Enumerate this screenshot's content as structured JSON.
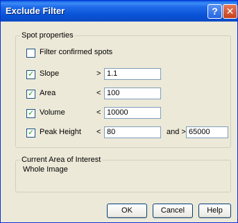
{
  "window": {
    "title": "Exclude Filter",
    "help_glyph": "?",
    "close_glyph": "✕"
  },
  "spot_properties": {
    "legend": "Spot properties",
    "filter_confirmed": {
      "label": "Filter confirmed spots",
      "checked": false
    },
    "rows": [
      {
        "label": "Slope",
        "checked": true,
        "operator": ">",
        "value": "1.1"
      },
      {
        "label": "Area",
        "checked": true,
        "operator": "<",
        "value": "100"
      },
      {
        "label": "Volume",
        "checked": true,
        "operator": "<",
        "value": "10000"
      },
      {
        "label": "Peak Height",
        "checked": true,
        "operator": "<",
        "value": "80",
        "and_label": "and >",
        "value2": "65000"
      }
    ]
  },
  "area_of_interest": {
    "legend": "Current Area of Interest",
    "value": "Whole Image"
  },
  "buttons": {
    "ok": "OK",
    "cancel": "Cancel",
    "help": "Help"
  }
}
